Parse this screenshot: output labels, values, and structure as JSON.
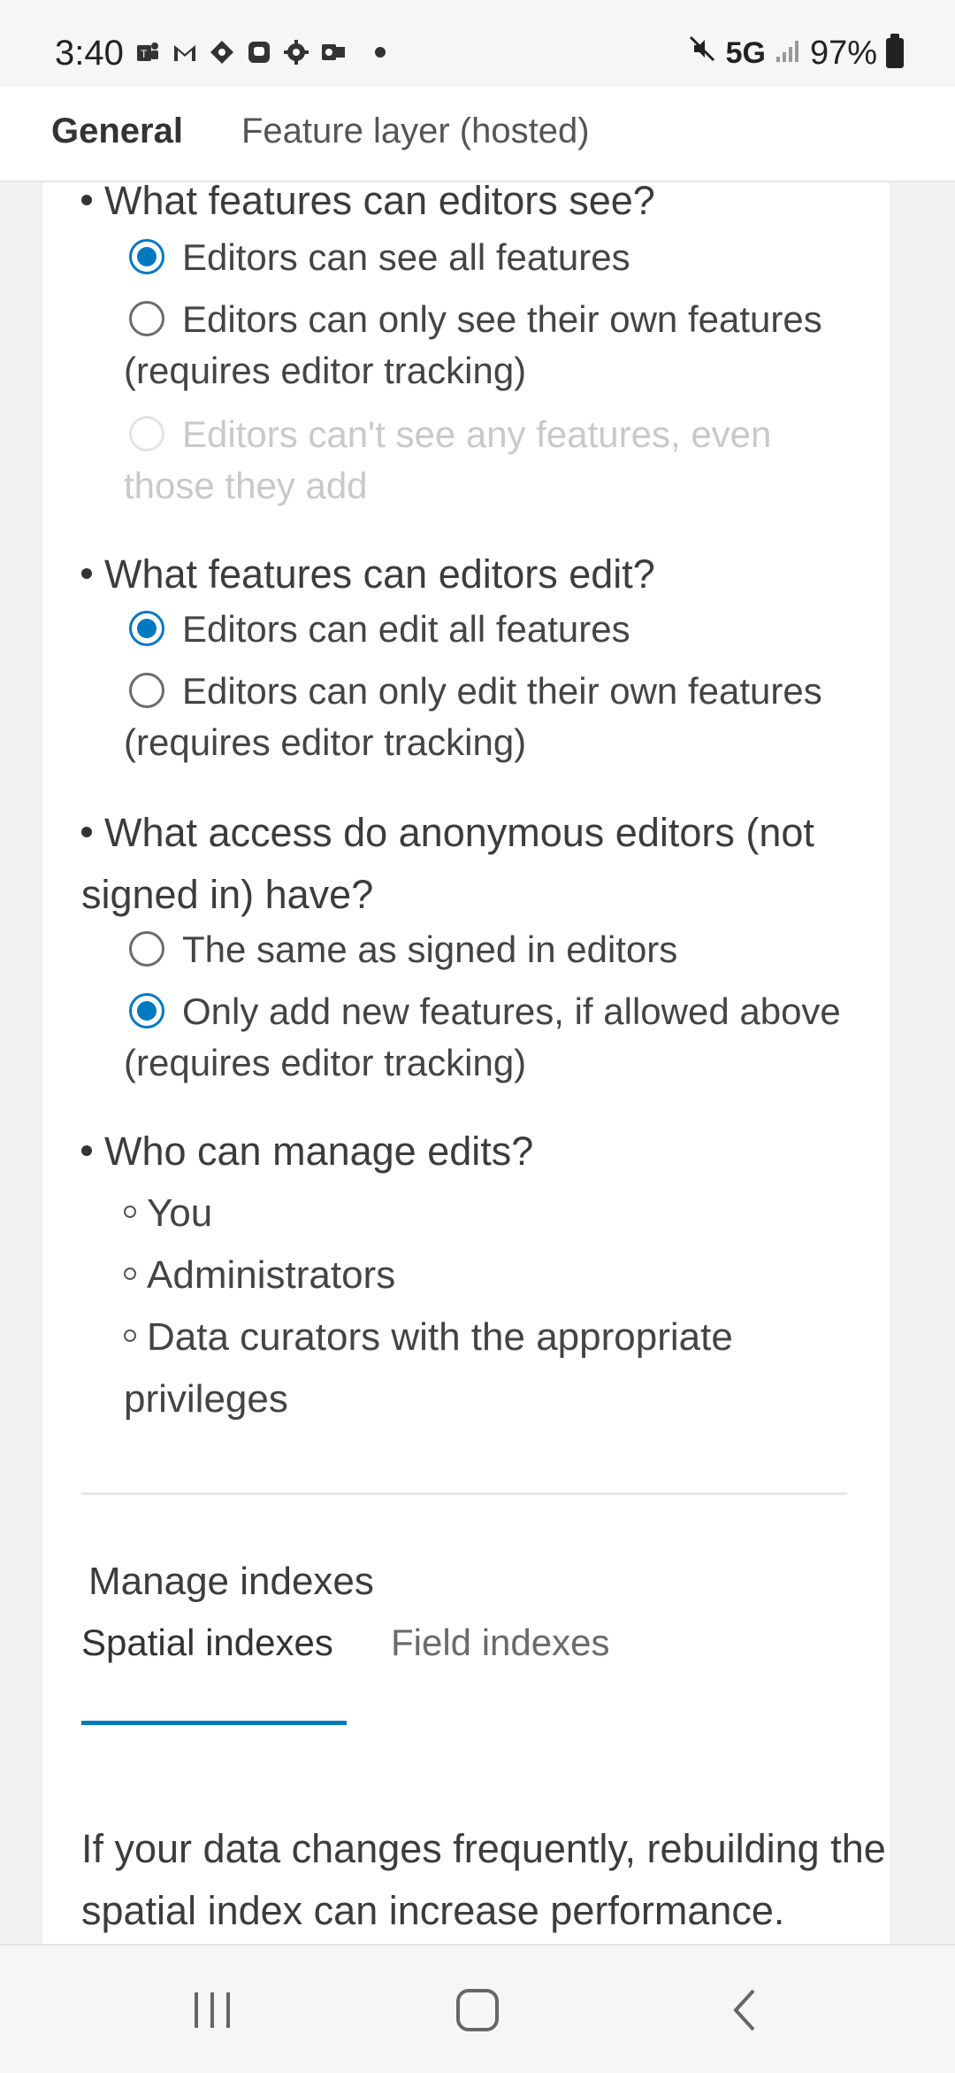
{
  "status_bar": {
    "time": "3:40",
    "network": "5G",
    "battery": "97%",
    "notification_icons": [
      "teams-icon",
      "gmail-icon",
      "tag-icon",
      "chat-icon",
      "gear-icon",
      "outlook-icon"
    ]
  },
  "header": {
    "tabs": [
      {
        "label": "General",
        "active": true
      },
      {
        "label": "Feature layer (hosted)",
        "active": false
      }
    ]
  },
  "editor_settings": {
    "q1": {
      "question": "What features can editors see?",
      "options": [
        {
          "label": "Editors can see all features",
          "checked": true,
          "disabled": false
        },
        {
          "label": "Editors can only see their own features (requires editor tracking)",
          "checked": false,
          "disabled": false
        },
        {
          "label": "Editors can't see any features, even those they add",
          "checked": false,
          "disabled": true
        }
      ]
    },
    "q2": {
      "question": "What features can editors edit?",
      "options": [
        {
          "label": "Editors can edit all features",
          "checked": true,
          "disabled": false
        },
        {
          "label": "Editors can only edit their own features (requires editor tracking)",
          "checked": false,
          "disabled": false
        }
      ]
    },
    "q3": {
      "question": "What access do anonymous editors (not signed in) have?",
      "options": [
        {
          "label": "The same as signed in editors",
          "checked": false,
          "disabled": false
        },
        {
          "label": "Only add new features, if allowed above (requires editor tracking)",
          "checked": true,
          "disabled": false
        }
      ]
    },
    "q4": {
      "question": "Who can manage edits?",
      "items": [
        "You",
        "Administrators",
        "Data curators with the appropriate privileges"
      ]
    }
  },
  "manage_indexes": {
    "title": "Manage indexes",
    "tabs": [
      {
        "label": "Spatial indexes",
        "active": true
      },
      {
        "label": "Field indexes",
        "active": false
      }
    ],
    "description": "If your data changes frequently, rebuilding the spatial index can increase performance."
  },
  "colors": {
    "accent": "#0079c1",
    "background": "#f2f2f2",
    "card": "#ffffff"
  }
}
